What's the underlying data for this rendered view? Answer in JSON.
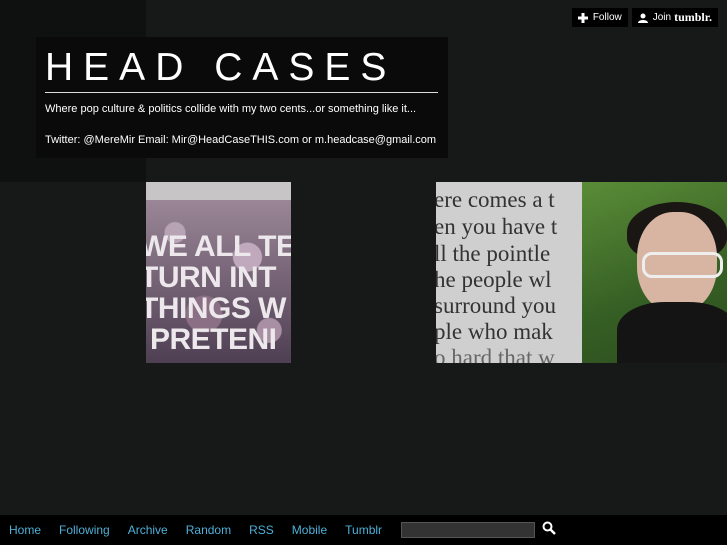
{
  "header": {
    "title": "HEAD CASES",
    "description_line1": "Where pop culture & politics collide with my two cents...or something like it...",
    "description_line2": "Twitter: @MereMir Email: Mir@HeadCaseTHIS.com or m.headcase@gmail.com"
  },
  "top_buttons": {
    "follow_label": "Follow",
    "join_label": "Join",
    "brand": "tumblr."
  },
  "posts": {
    "post1_lines": [
      "WE ALL TE",
      "TURN INT",
      "THINGS W",
      "PRETENI"
    ],
    "post2_lines": [
      "ere comes a t",
      "en you have t",
      "ll the pointle",
      "he people wl",
      "surround you",
      "ple who mak",
      "o hard that w"
    ]
  },
  "nav": {
    "items": [
      "Home",
      "Following",
      "Archive",
      "Random",
      "RSS",
      "Mobile",
      "Tumblr"
    ],
    "search_placeholder": ""
  },
  "colors": {
    "background": "#171919",
    "nav_link": "#4fb0d8"
  }
}
